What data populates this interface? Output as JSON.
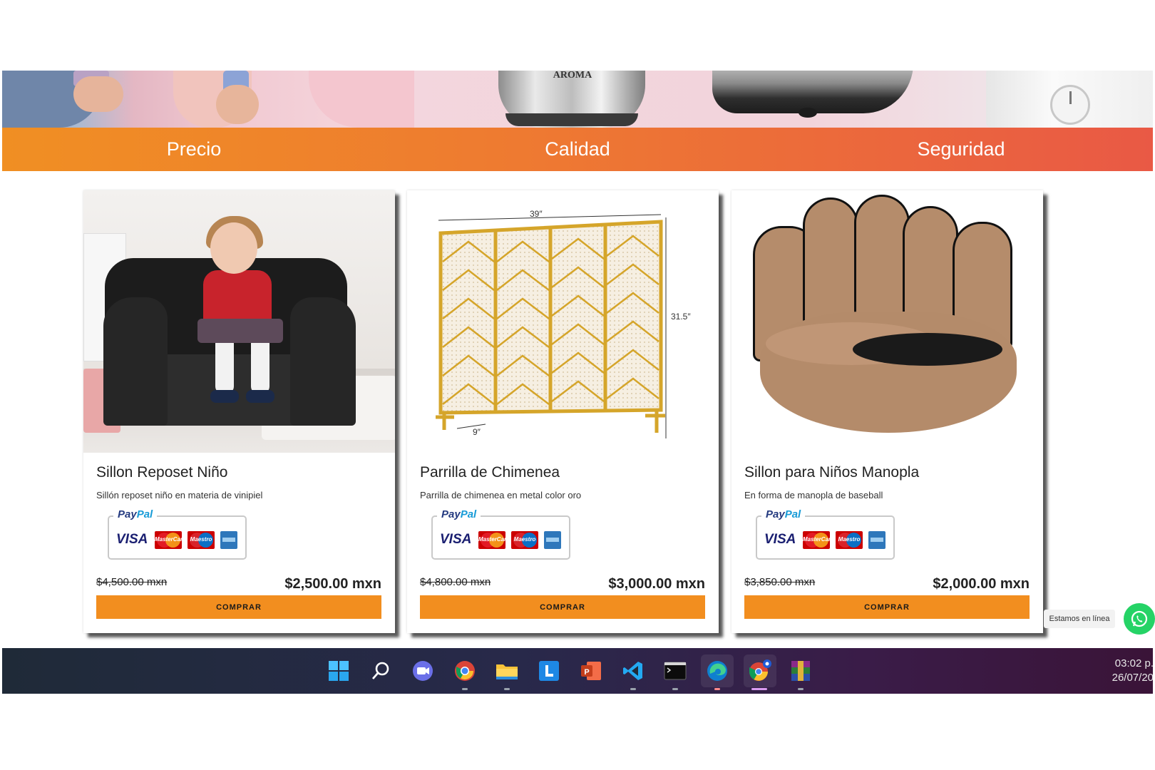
{
  "hero": {
    "brand_text": "AROMA"
  },
  "features": [
    "Precio",
    "Calidad",
    "Seguridad"
  ],
  "products": [
    {
      "title": "Sillon Reposet Niño",
      "description": "Sillón reposet niño en materia de vinipiel",
      "old_price": "$4,500.00 mxn",
      "price": "$2,500.00 mxn",
      "button": "COMPRAR"
    },
    {
      "title": "Parrilla de Chimenea",
      "description": "Parrilla de chimenea en metal color oro",
      "old_price": "$4,800.00 mxn",
      "price": "$3,000.00 mxn",
      "button": "COMPRAR",
      "dimensions": {
        "width": "39″",
        "height": "31.5″",
        "depth": "9″"
      }
    },
    {
      "title": "Sillon para Niños Manopla",
      "description": "En forma de manopla de baseball",
      "old_price": "$3,850.00 mxn",
      "price": "$2,000.00 mxn",
      "button": "COMPRAR"
    }
  ],
  "payment_badge": {
    "paypal_a": "Pay",
    "paypal_b": "Pal",
    "visa": "VISA",
    "mastercard": "MasterCard",
    "maestro": "Maestro"
  },
  "whatsapp": {
    "label": "Estamos en línea",
    "icon": "whatsapp-icon"
  },
  "taskbar": {
    "icons": [
      "windows-start-icon",
      "search-icon",
      "meet-icon",
      "chrome-icon",
      "file-explorer-icon",
      "l-app-icon",
      "powerpoint-icon",
      "vscode-icon",
      "terminal-icon",
      "edge-icon",
      "chrome-profile-icon",
      "winrar-icon"
    ],
    "time": "03:02 p.",
    "date": "26/07/20"
  },
  "colors": {
    "accent": "#f28e1f",
    "band_start": "#f08f23",
    "band_end": "#e95945",
    "whatsapp": "#25d366"
  }
}
